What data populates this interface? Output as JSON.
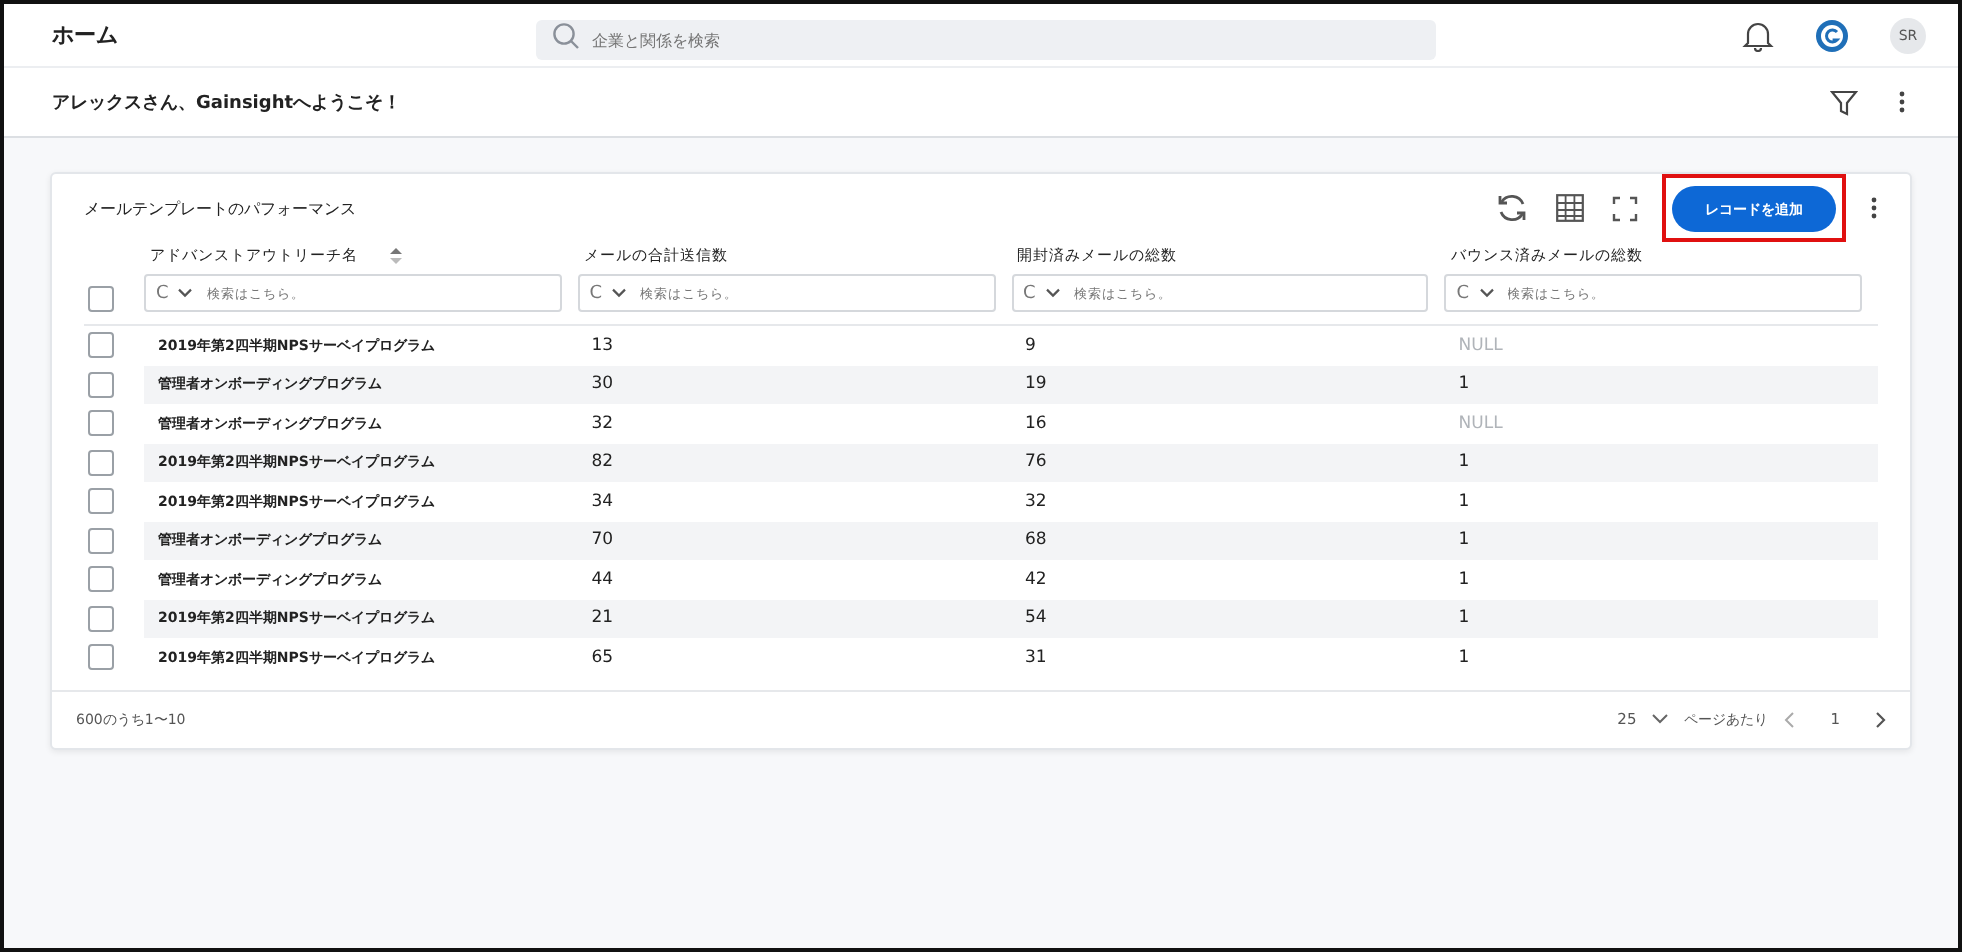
{
  "header": {
    "title": "ホーム",
    "search": {
      "placeholder": "企業と関係を検索"
    },
    "avatar": "SR"
  },
  "welcome": {
    "text": "アレックスさん、Gainsightへようこそ！"
  },
  "widget": {
    "title": "メールテンプレートのパフォーマンス",
    "add_button": {
      "label": "レコードを追加",
      "highlighted": true
    },
    "columns": [
      {
        "label": "アドバンストアウトリーチ名",
        "sortable": true,
        "filter": {
          "operator": "C",
          "placeholder": "検索はこちら。"
        }
      },
      {
        "label": "メールの合計送信数",
        "sortable": false,
        "filter": {
          "operator": "C",
          "placeholder": "検索はこちら。"
        }
      },
      {
        "label": "開封済みメールの総数",
        "sortable": false,
        "filter": {
          "operator": "C",
          "placeholder": "検索はこちら。"
        }
      },
      {
        "label": "バウンス済みメールの総数",
        "sortable": false,
        "filter": {
          "operator": "C",
          "placeholder": "検索はこちら。"
        }
      }
    ],
    "select_all": {
      "checked": false
    },
    "rows": [
      {
        "checked": false,
        "cells": [
          {
            "text": "2019年第2四半期NPSサーベイプログラム",
            "empty": false
          },
          {
            "text": "13",
            "empty": false
          },
          {
            "text": "9",
            "empty": false
          },
          {
            "text": "NULL",
            "empty": true
          }
        ]
      },
      {
        "checked": false,
        "cells": [
          {
            "text": "管理者オンボーディングプログラム",
            "empty": false
          },
          {
            "text": "30",
            "empty": false
          },
          {
            "text": "19",
            "empty": false
          },
          {
            "text": "1",
            "empty": false
          }
        ]
      },
      {
        "checked": false,
        "cells": [
          {
            "text": "管理者オンボーディングプログラム",
            "empty": false
          },
          {
            "text": "32",
            "empty": false
          },
          {
            "text": "16",
            "empty": false
          },
          {
            "text": "NULL",
            "empty": true
          }
        ]
      },
      {
        "checked": false,
        "cells": [
          {
            "text": "2019年第2四半期NPSサーベイプログラム",
            "empty": false
          },
          {
            "text": "82",
            "empty": false
          },
          {
            "text": "76",
            "empty": false
          },
          {
            "text": "1",
            "empty": false
          }
        ]
      },
      {
        "checked": false,
        "cells": [
          {
            "text": "2019年第2四半期NPSサーベイプログラム",
            "empty": false
          },
          {
            "text": "34",
            "empty": false
          },
          {
            "text": "32",
            "empty": false
          },
          {
            "text": "1",
            "empty": false
          }
        ]
      },
      {
        "checked": false,
        "cells": [
          {
            "text": "管理者オンボーディングプログラム",
            "empty": false
          },
          {
            "text": "70",
            "empty": false
          },
          {
            "text": "68",
            "empty": false
          },
          {
            "text": "1",
            "empty": false
          }
        ]
      },
      {
        "checked": false,
        "cells": [
          {
            "text": "管理者オンボーディングプログラム",
            "empty": false
          },
          {
            "text": "44",
            "empty": false
          },
          {
            "text": "42",
            "empty": false
          },
          {
            "text": "1",
            "empty": false
          }
        ]
      },
      {
        "checked": false,
        "cells": [
          {
            "text": "2019年第2四半期NPSサーベイプログラム",
            "empty": false
          },
          {
            "text": "21",
            "empty": false
          },
          {
            "text": "54",
            "empty": false
          },
          {
            "text": "1",
            "empty": false
          }
        ]
      },
      {
        "checked": false,
        "cells": [
          {
            "text": "2019年第2四半期NPSサーベイプログラム",
            "empty": false
          },
          {
            "text": "65",
            "empty": false
          },
          {
            "text": "31",
            "empty": false
          },
          {
            "text": "1",
            "empty": false
          }
        ]
      }
    ],
    "footer": {
      "range": "600のうち1〜10",
      "page_size": "25",
      "per_page_label": "ページあたり",
      "page": "1"
    }
  }
}
